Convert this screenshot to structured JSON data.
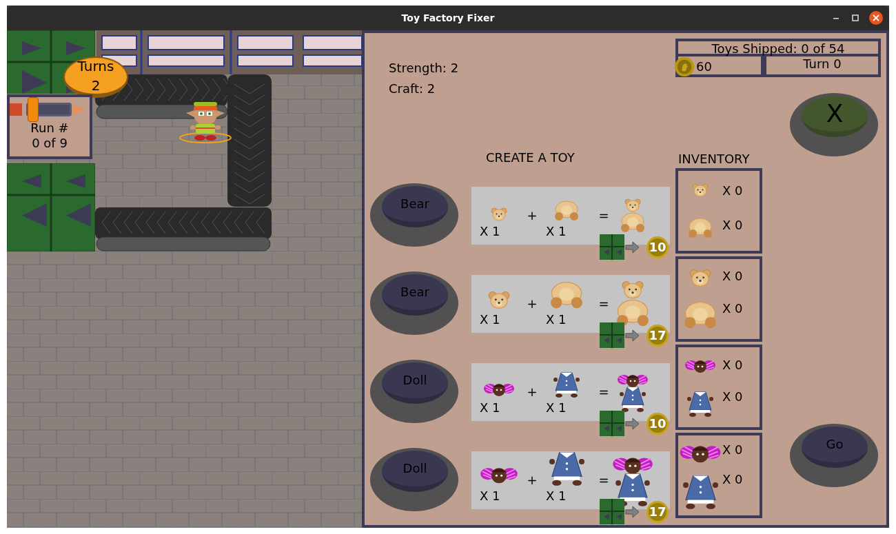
{
  "window": {
    "title": "Toy Factory Fixer"
  },
  "board": {
    "turns_label": "Turns",
    "turns_value": "2",
    "run_label": "Run #",
    "run_value": "0 of 9",
    "run_slider": {
      "level": 0.15
    }
  },
  "stats": [
    "Strength: 2",
    "Craft: 2"
  ],
  "status": {
    "toys_shipped": "Toys Shipped: 0 of 54",
    "coins": "60",
    "turn": "Turn 0"
  },
  "close_button": "X",
  "create_heading": "CREATE A TOY",
  "recipes": [
    {
      "button": "Bear",
      "kind": "minibear",
      "part1_qty": "X 1",
      "plus": "+",
      "part2_qty": "X 1",
      "equals": "=",
      "reward": "10"
    },
    {
      "button": "Bear",
      "kind": "bigbear",
      "part1_qty": "X 1",
      "plus": "+",
      "part2_qty": "X 1",
      "equals": "=",
      "reward": "17"
    },
    {
      "button": "Doll",
      "kind": "minidoll",
      "part1_qty": "X 1",
      "plus": "+",
      "part2_qty": "X 1",
      "equals": "=",
      "reward": "10"
    },
    {
      "button": "Doll",
      "kind": "bigdoll",
      "part1_qty": "X 1",
      "plus": "+",
      "part2_qty": "X 1",
      "equals": "=",
      "reward": "17"
    }
  ],
  "inventory_heading": "INVENTORY",
  "inventory": [
    {
      "kind": "minibear",
      "part1_count": "X 0",
      "part2_count": "X 0"
    },
    {
      "kind": "bigbear",
      "part1_count": "X 0",
      "part2_count": "X 0"
    },
    {
      "kind": "minidoll",
      "part1_count": "X 0",
      "part2_count": "X 0"
    },
    {
      "kind": "bigdoll",
      "part1_count": "X 0",
      "part2_count": "X 0"
    }
  ],
  "go_button": "Go"
}
